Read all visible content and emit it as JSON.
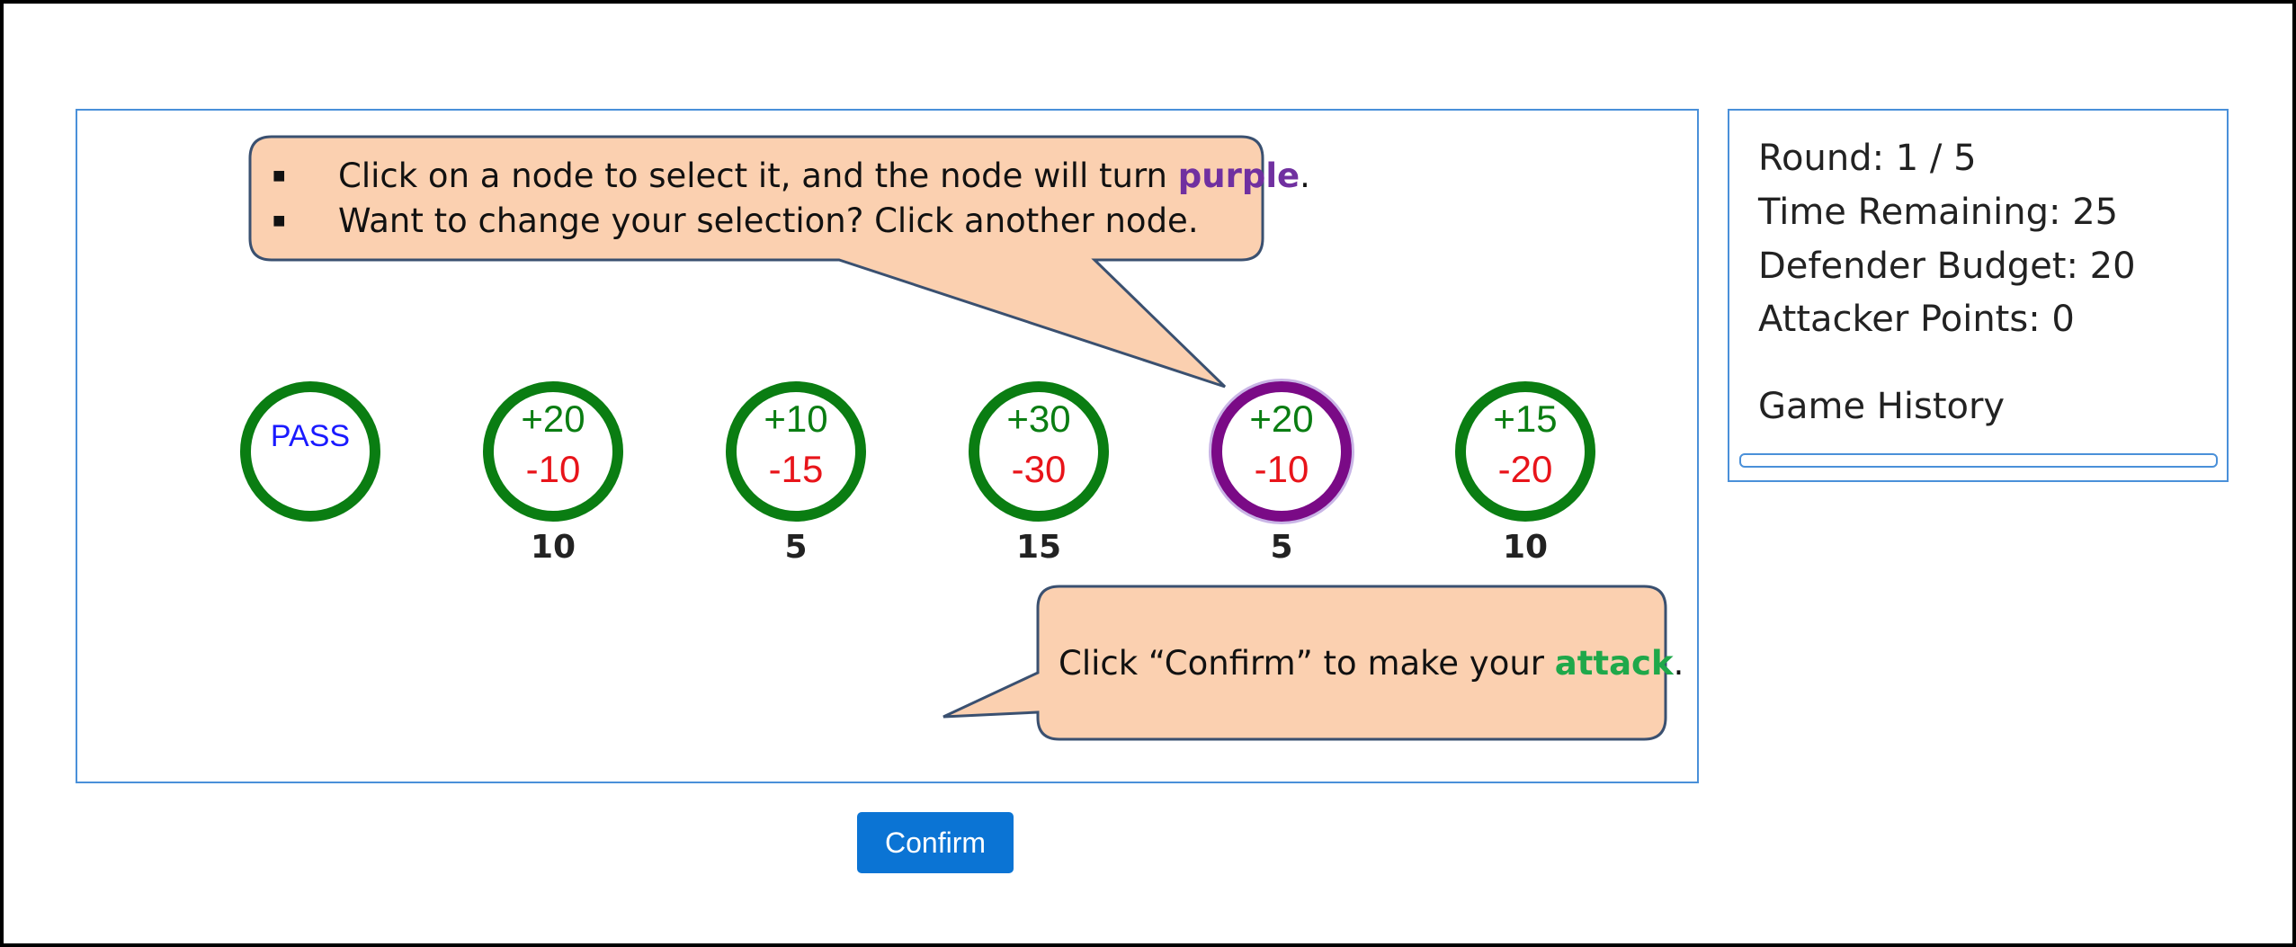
{
  "stats": {
    "round": "Round: 1 / 5",
    "time": "Time Remaining: 25",
    "budget": "Defender Budget: 20",
    "points": "Attacker Points: 0",
    "history_title": "Game History"
  },
  "nodes": [
    {
      "label": "PASS",
      "cost": ""
    },
    {
      "plus": "+20",
      "minus": "-10",
      "cost": "10"
    },
    {
      "plus": "+10",
      "minus": "-15",
      "cost": "5"
    },
    {
      "plus": "+30",
      "minus": "-30",
      "cost": "15"
    },
    {
      "plus": "+20",
      "minus": "-10",
      "cost": "5",
      "selected": true
    },
    {
      "plus": "+15",
      "minus": "-20",
      "cost": "10"
    }
  ],
  "confirm_label": "Confirm",
  "callout_top": {
    "line1_pre": "Click on a node to select it, and the node will turn ",
    "line1_highlight": "purple",
    "line1_post": ".",
    "line2": "Want to change your selection? Click another node."
  },
  "callout_bottom": {
    "pre": "Click “Confirm” to make your ",
    "highlight": "attack",
    "post": "."
  },
  "colors": {
    "node_ring": "#0a7d12",
    "selected_ring": "#7a0a86",
    "gain": "#0a7d12",
    "loss": "#e8141a",
    "pass_text": "#1a1aff",
    "confirm_bg": "#0b74d4",
    "callout_fill": "#fbd0b0",
    "callout_stroke": "#3a5070",
    "panel_border": "#4a90d9"
  },
  "icons": {
    "bullet": "square-bullet-icon"
  }
}
